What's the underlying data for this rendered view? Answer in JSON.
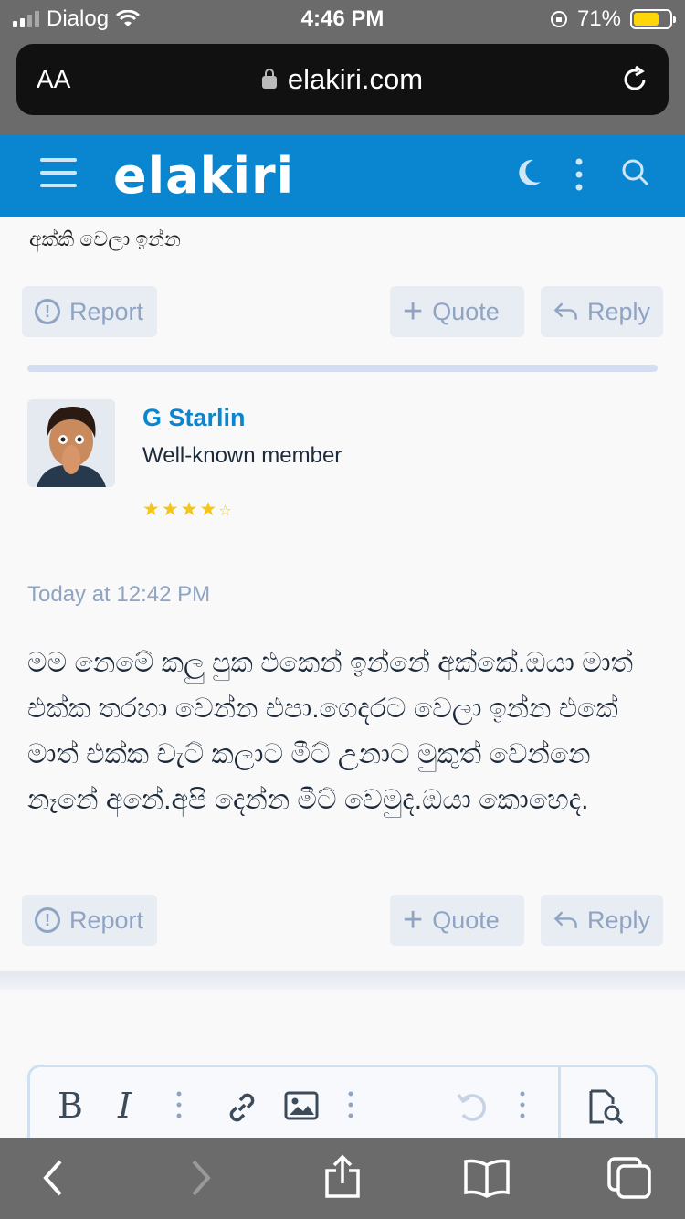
{
  "status_bar": {
    "carrier": "Dialog",
    "time": "4:46 PM",
    "battery": "71%",
    "battery_level": 0.71
  },
  "browser": {
    "text_size_label": "AA",
    "url": "elakiri.com"
  },
  "site": {
    "logo": "elakiri"
  },
  "previous_post": {
    "text": "අක්කි වෙලා ඉන්න",
    "actions": {
      "report": "Report",
      "quote": "Quote",
      "reply": "Reply"
    }
  },
  "post": {
    "username": "G Starlin",
    "user_title": "Well-known member",
    "rating": 4.5,
    "time": "Today at 12:42 PM",
    "body": "මම නෙමේ කලු පුක එකෙන් ඉන්නේ අක්කේ.ඔයා මාත් එක්ක තරහා වෙන්න එපා.ගෙදරට වෙලා ඉන්න එකේ මාත් එක්ක චැට් කලාට මීට් උනාට මුකුත් වෙන්නෙ නෑනේ අනේ.අපි දෙන්න මීට් වෙමුද.ඔයා කොහෙද.",
    "actions": {
      "report": "Report",
      "quote": "Quote",
      "reply": "Reply"
    }
  },
  "colors": {
    "brand": "#0a86d0",
    "muted": "#8fa3c2",
    "star": "#f5c518"
  },
  "icons": {
    "header": [
      "menu-icon",
      "dark-mode-icon",
      "more-options-icon",
      "search-icon"
    ],
    "editor": [
      "bold-icon",
      "italic-icon",
      "more-icon",
      "link-icon",
      "image-icon",
      "more-icon",
      "undo-icon",
      "more-icon",
      "preview-icon"
    ],
    "browser_toolbar": [
      "back-icon",
      "forward-icon",
      "share-icon",
      "bookmarks-icon",
      "tabs-icon"
    ]
  }
}
